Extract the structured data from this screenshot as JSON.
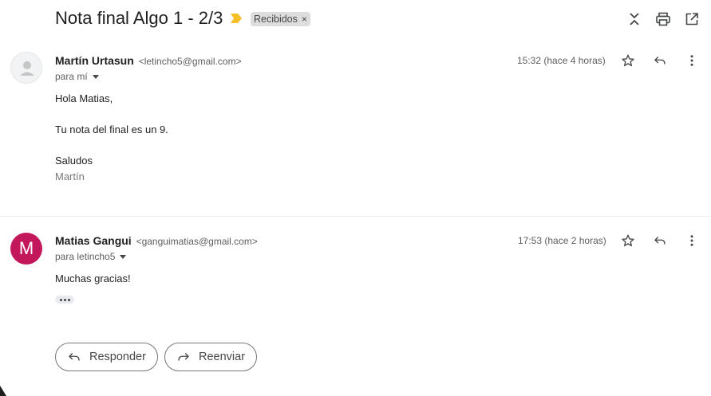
{
  "header": {
    "subject": "Nota final Algo 1 - 2/3",
    "label": "Recibidos",
    "label_remove": "×",
    "icons": [
      "importance-marker-icon",
      "collapse-all-icon",
      "print-icon",
      "open-in-new-window-icon"
    ]
  },
  "messages": [
    {
      "sender_name": "Martín Urtasun",
      "sender_email": "<letincho5@gmail.com>",
      "recipient": "para mí",
      "time": "15:32 (hace 4 horas)",
      "body": [
        "Hola Matias,",
        "Tu nota del final es un 9.",
        "Saludos"
      ],
      "signature": "Martín"
    },
    {
      "sender_name": "Matias Gangui",
      "sender_email": "<ganguimatias@gmail.com>",
      "recipient": "para letincho5",
      "time": "17:53 (hace 2 horas)",
      "avatar_letter": "M",
      "avatar_color": "#c2185b",
      "body": [
        "Muchas gracias!"
      ]
    }
  ],
  "actions": {
    "reply": "Responder",
    "forward": "Reenviar"
  },
  "colors": {
    "importance": "#f6bf26",
    "chip_bg": "#dddddd",
    "text": "#202124",
    "muted": "#5e5e5e"
  }
}
